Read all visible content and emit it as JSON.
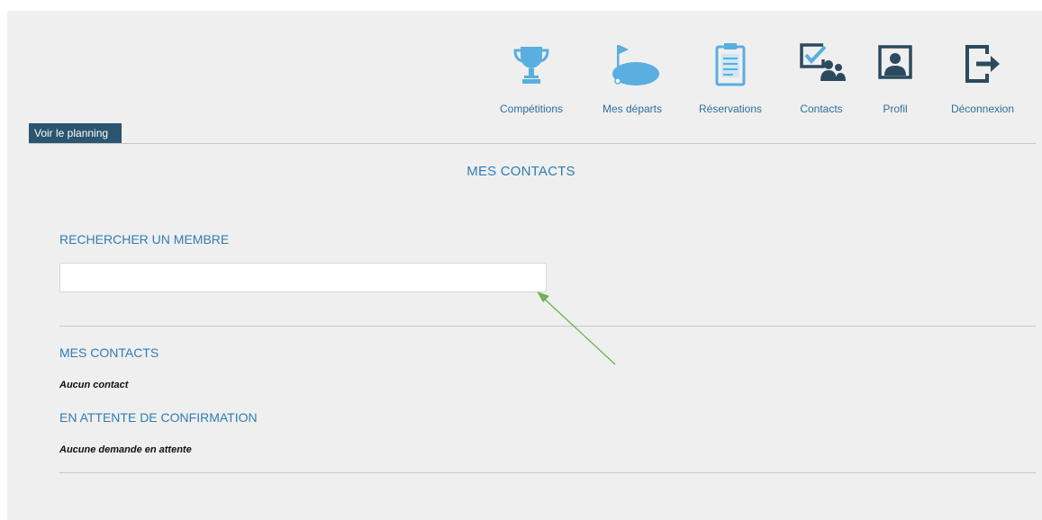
{
  "colors": {
    "accent": "#2f7db2",
    "icon_blue": "#5aaee0",
    "dark_icon": "#2b4a5e",
    "button_bg": "#2b5570",
    "arrow": "#6fb34a"
  },
  "nav": {
    "items": [
      {
        "label": "Compétitions",
        "icon": "trophy-icon"
      },
      {
        "label": "Mes départs",
        "icon": "golf-flag-icon"
      },
      {
        "label": "Réservations",
        "icon": "clipboard-icon"
      },
      {
        "label": "Contacts",
        "icon": "contacts-icon"
      },
      {
        "label": "Profil",
        "icon": "profile-icon"
      },
      {
        "label": "Déconnexion",
        "icon": "logout-icon"
      }
    ]
  },
  "planning_button": "Voir le planning",
  "page_title": "MES CONTACTS",
  "search": {
    "title": "RECHERCHER UN MEMBRE",
    "value": "",
    "placeholder": ""
  },
  "contacts": {
    "title": "MES CONTACTS",
    "empty": "Aucun contact"
  },
  "pending": {
    "title": "EN ATTENTE DE CONFIRMATION",
    "empty": "Aucune demande en attente"
  }
}
